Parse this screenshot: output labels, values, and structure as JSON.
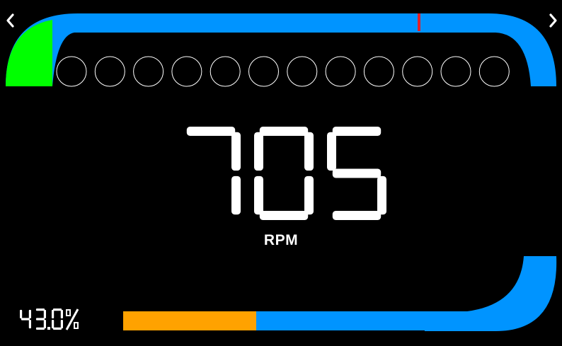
{
  "dashboard": {
    "rpm_value": "705",
    "rpm_unit": "RPM",
    "percent_readout": "43.0%",
    "bar_fill_fraction": 0.43,
    "shift_lights_count": 12,
    "colors": {
      "background": "#000000",
      "arc_blue": "#0094ff",
      "arc_green": "#00ff00",
      "marker_red": "#e0202a",
      "bar_orange": "#ffa200",
      "digit_white": "#ffffff"
    },
    "icons": {
      "nav_left": "chevron-left-icon",
      "nav_right": "chevron-right-icon"
    }
  }
}
